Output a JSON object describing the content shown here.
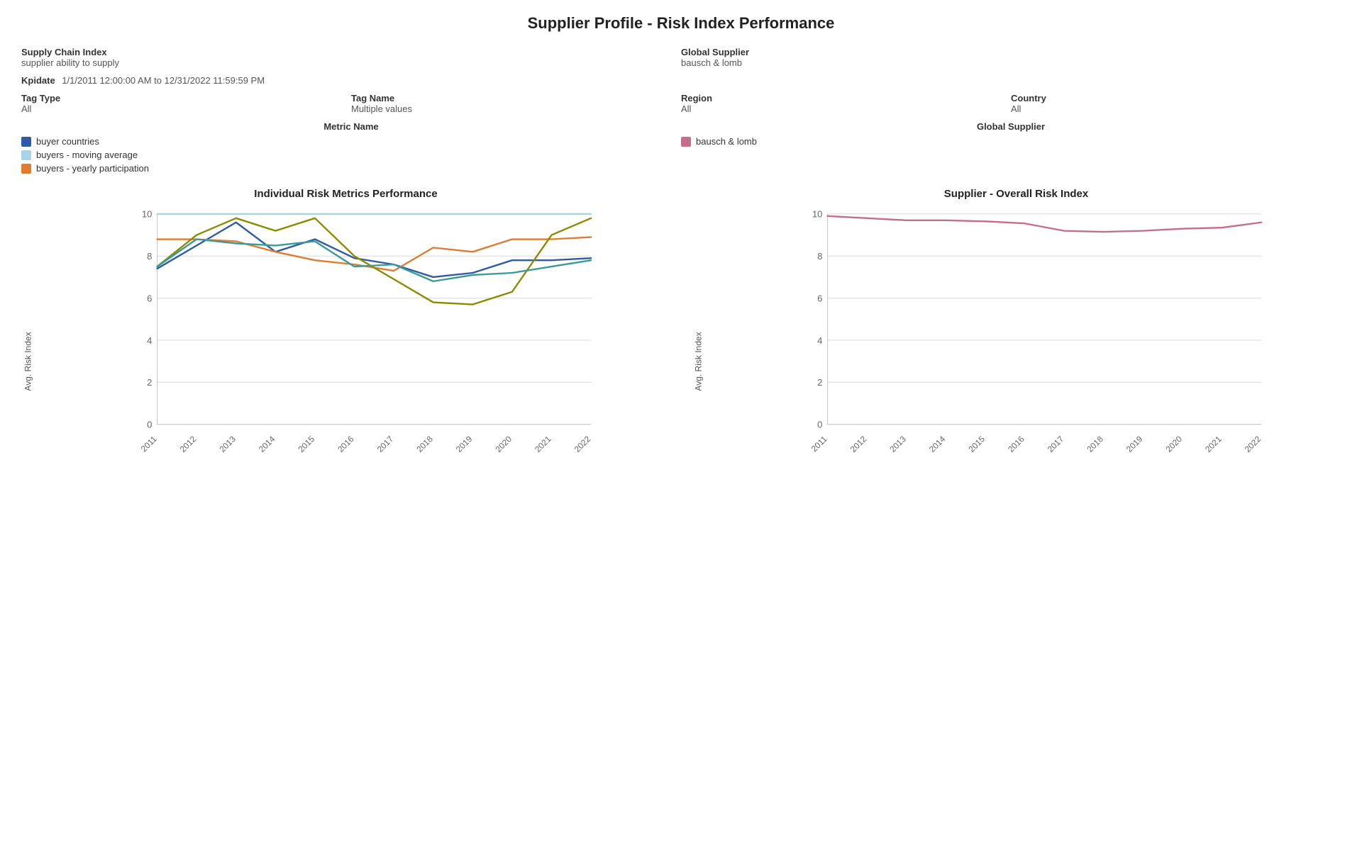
{
  "page": {
    "title": "Supplier Profile - Risk Index Performance"
  },
  "meta": {
    "supply_chain_index_label": "Supply Chain Index",
    "supply_chain_index_value": "supplier ability to supply",
    "global_supplier_label": "Global Supplier",
    "global_supplier_value": "bausch & lomb",
    "kpidate_label": "Kpidate",
    "kpidate_value": "1/1/2011 12:00:00 AM to 12/31/2022 11:59:59 PM"
  },
  "filters": {
    "tag_type_label": "Tag Type",
    "tag_type_value": "All",
    "tag_name_label": "Tag Name",
    "tag_name_value": "Multiple values",
    "region_label": "Region",
    "region_value": "All",
    "country_label": "Country",
    "country_value": "All"
  },
  "legend": {
    "metric_name_title": "Metric Name",
    "global_supplier_title": "Global Supplier",
    "metrics": [
      {
        "label": "buyer countries",
        "color": "#2d5ca6"
      },
      {
        "label": "buyers - moving average",
        "color": "#a8d4e8"
      },
      {
        "label": "buyers - yearly participation",
        "color": "#e07b30"
      }
    ],
    "suppliers": [
      {
        "label": "bausch & lomb",
        "color": "#c96b8a"
      }
    ]
  },
  "chart1": {
    "title": "Individual Risk Metrics Performance",
    "y_label": "Avg. Risk Index",
    "x_years": [
      "2011",
      "2012",
      "2013",
      "2014",
      "2015",
      "2016",
      "2017",
      "2018",
      "2019",
      "2020",
      "2021",
      "2022"
    ],
    "y_ticks": [
      0,
      2,
      4,
      6,
      8,
      10
    ],
    "series": [
      {
        "name": "buyer countries",
        "color": "#2d5ca6",
        "points": [
          7.4,
          8.5,
          9.6,
          8.2,
          8.8,
          7.9,
          7.6,
          7.0,
          7.2,
          7.8,
          7.8,
          7.9
        ]
      },
      {
        "name": "buyers - moving average",
        "color": "#a8d4e8",
        "points": [
          10.0,
          10.0,
          10.0,
          10.0,
          10.0,
          10.0,
          10.0,
          10.0,
          10.0,
          10.0,
          10.0,
          10.0
        ]
      },
      {
        "name": "buyers - yearly participation",
        "color": "#e07b30",
        "points": [
          8.8,
          8.8,
          8.7,
          8.2,
          7.8,
          7.6,
          7.3,
          8.4,
          8.2,
          8.8,
          8.8,
          8.9
        ]
      },
      {
        "name": "olive line",
        "color": "#8b8b00",
        "points": [
          7.5,
          9.0,
          9.8,
          9.2,
          9.8,
          8.0,
          6.9,
          5.8,
          5.7,
          6.3,
          9.0,
          9.8
        ]
      },
      {
        "name": "teal line",
        "color": "#3a9999",
        "points": [
          7.5,
          8.8,
          8.6,
          8.5,
          8.7,
          7.5,
          7.6,
          6.8,
          7.1,
          7.2,
          7.5,
          7.8
        ]
      }
    ]
  },
  "chart2": {
    "title": "Supplier - Overall Risk Index",
    "y_label": "Avg. Risk Index",
    "x_years": [
      "2011",
      "2012",
      "2013",
      "2014",
      "2015",
      "2016",
      "2017",
      "2018",
      "2019",
      "2020",
      "2021",
      "2022"
    ],
    "y_ticks": [
      0,
      2,
      4,
      6,
      8,
      10
    ],
    "series": [
      {
        "name": "bausch & lomb",
        "color": "#c96b8a",
        "points": [
          9.9,
          9.8,
          9.7,
          9.7,
          9.65,
          9.55,
          9.2,
          9.15,
          9.2,
          9.3,
          9.35,
          9.6
        ]
      }
    ]
  },
  "colors": {
    "grid_line": "#e0e0e0",
    "axis_text": "#666"
  }
}
